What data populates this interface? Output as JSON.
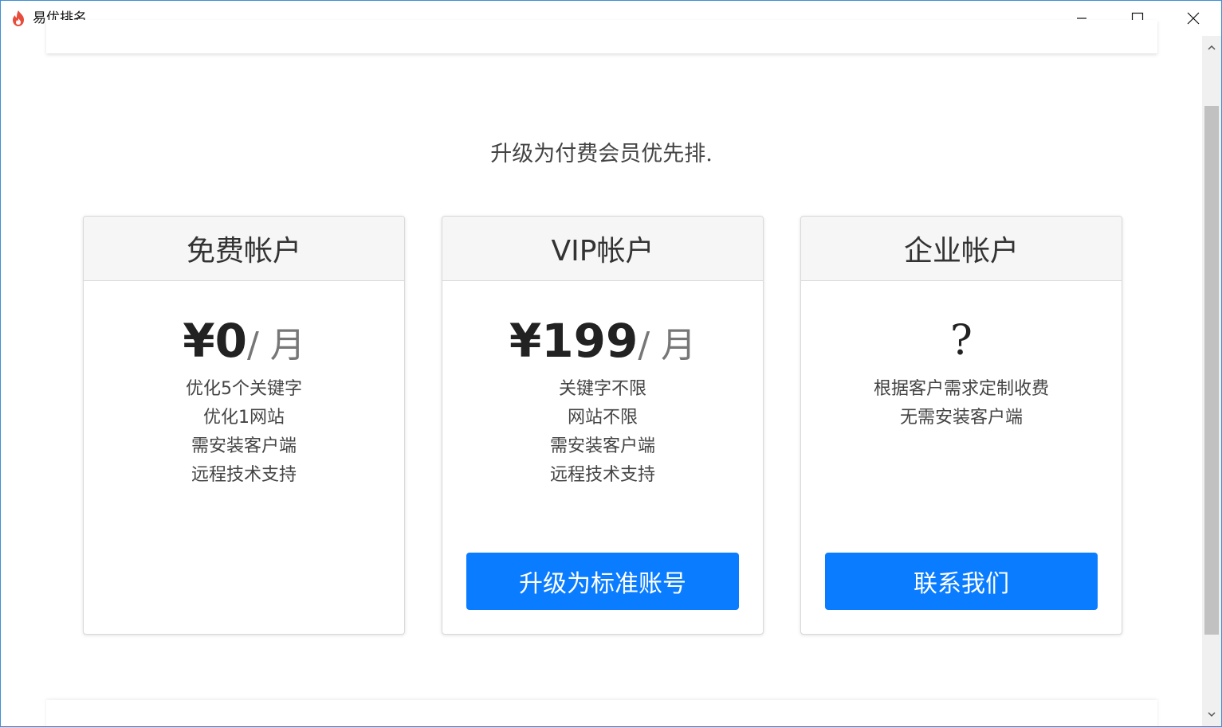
{
  "window": {
    "title": "易优排名",
    "icon": "flame-logo-icon",
    "controls": [
      "minimize-icon",
      "maximize-icon",
      "close-icon"
    ]
  },
  "page": {
    "heading": "升级为付费会员优先排."
  },
  "plans": [
    {
      "title": "免费帐户",
      "price": "¥0",
      "unit": "/ 月",
      "features": [
        "优化5个关键字",
        "优化1网站",
        "需安装客户端",
        "远程技术支持"
      ]
    },
    {
      "title": "VIP帐户",
      "price": "¥199",
      "unit": "/ 月",
      "features": [
        "关键字不限",
        "网站不限",
        "需安装客户端",
        "远程技术支持"
      ],
      "button": "升级为标准账号"
    },
    {
      "title": "企业帐户",
      "price": "?",
      "features": [
        "根据客户需求定制收费",
        "无需安装客户端"
      ],
      "button": "联系我们"
    }
  ],
  "colors": {
    "accent": "#0a7cff",
    "header_bg": "#f6f6f6",
    "window_border": "#3c8fd6"
  }
}
